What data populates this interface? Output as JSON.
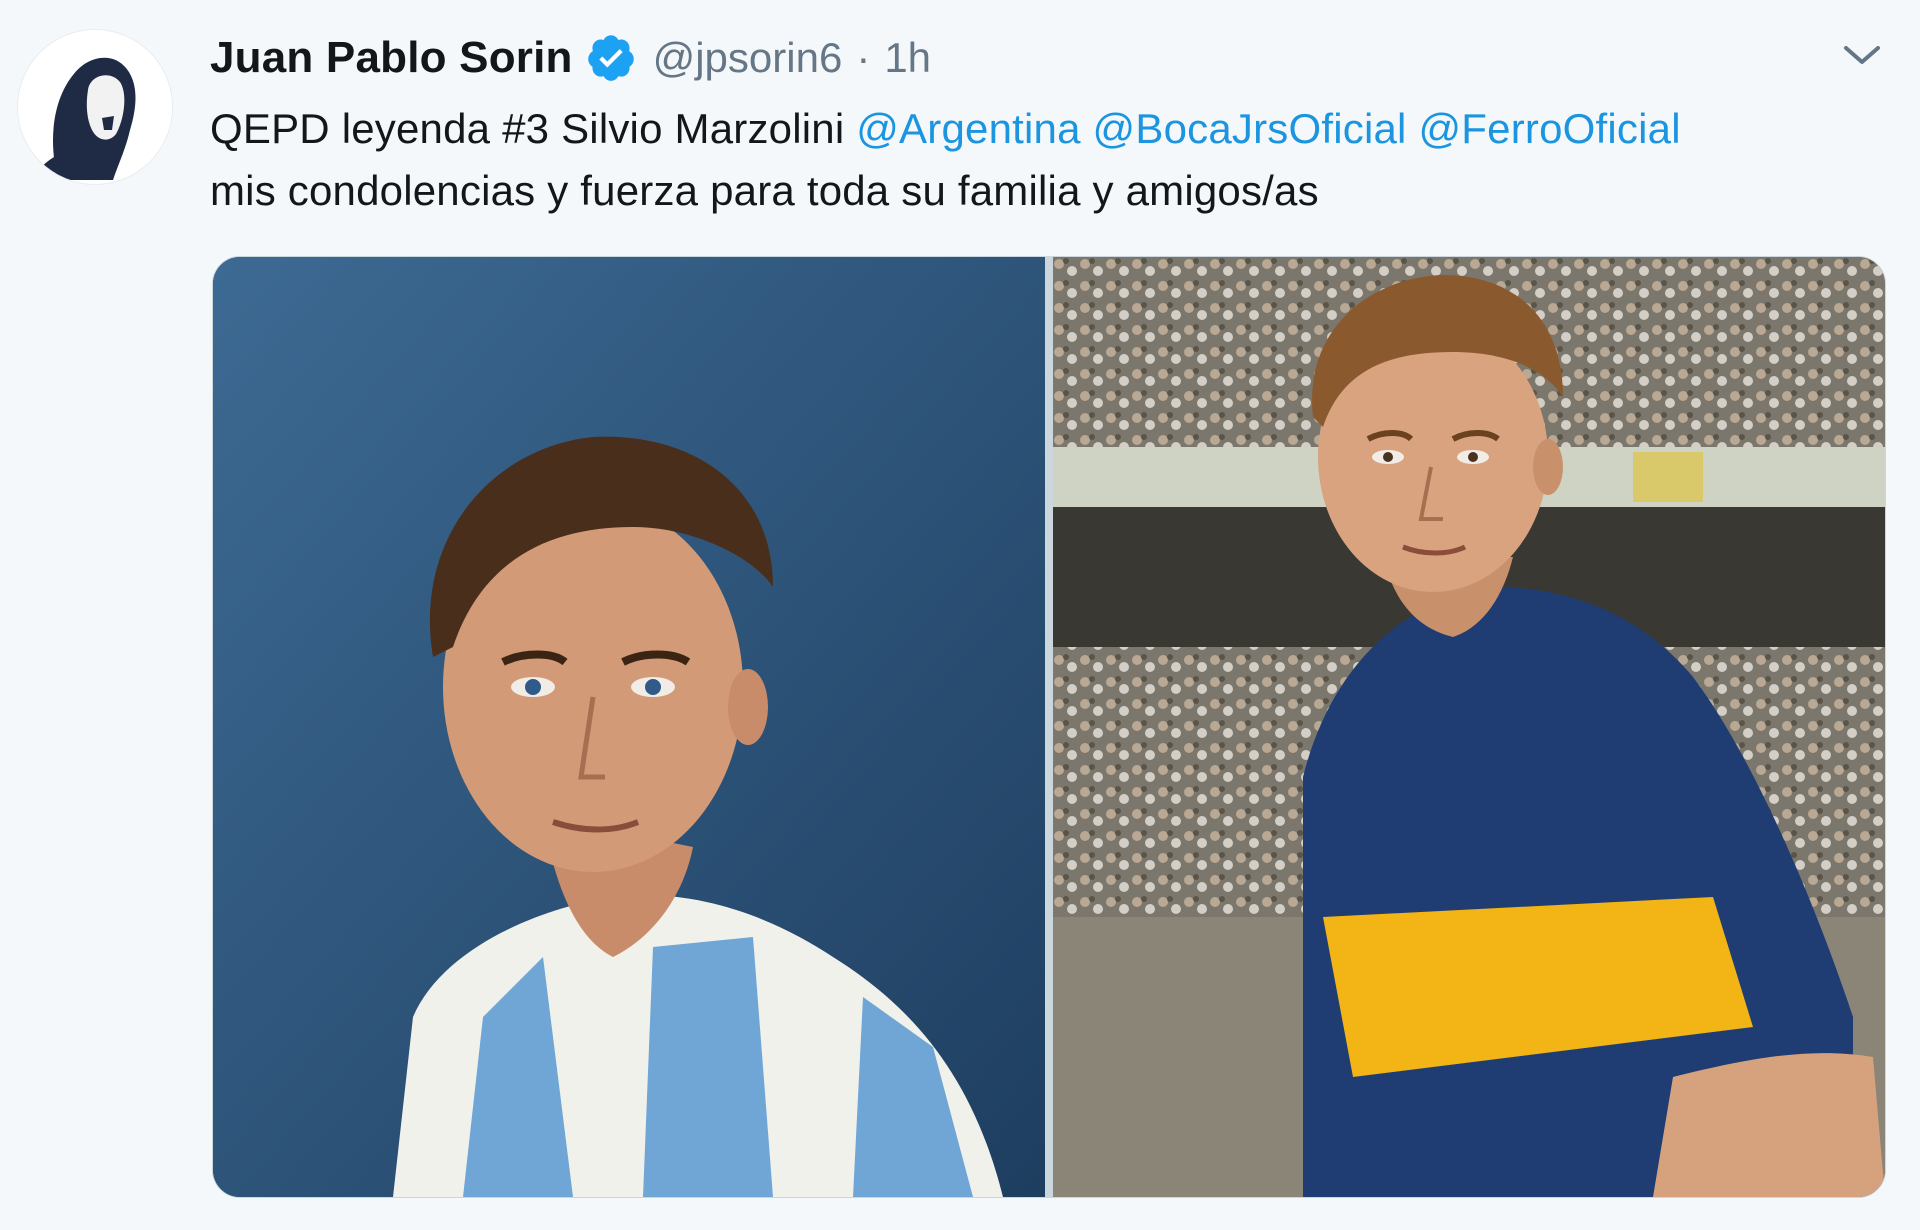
{
  "tweet": {
    "author": {
      "display_name": "Juan Pablo Sorin",
      "handle": "@jpsorin6",
      "verified": true,
      "avatar": "illustrated-portrait-avatar"
    },
    "separator": "·",
    "timestamp": "1h",
    "text": {
      "line1_prefix": "QEPD leyenda #3 Silvio Marzolini ",
      "mentions": [
        "@Argentina",
        "@BocaJrsOficial",
        "@FerroOficial"
      ],
      "line2": "mis condolencias y fuerza para toda su familia y amigos/as"
    },
    "media": [
      {
        "name": "photo-argentina-jersey",
        "jersey_colors": [
          "#6fa6d6",
          "#f4f4f0"
        ],
        "background": "#2a4f76"
      },
      {
        "name": "photo-boca-jersey",
        "jersey_colors": [
          "#1f3d73",
          "#f2b515"
        ],
        "background": "#6e6a62"
      }
    ],
    "icons": {
      "verified": "verified-badge-icon",
      "menu": "chevron-down-icon"
    },
    "colors": {
      "link": "#1b95e0",
      "verified": "#1da1f2",
      "muted": "#657786",
      "text": "#14171a"
    }
  }
}
